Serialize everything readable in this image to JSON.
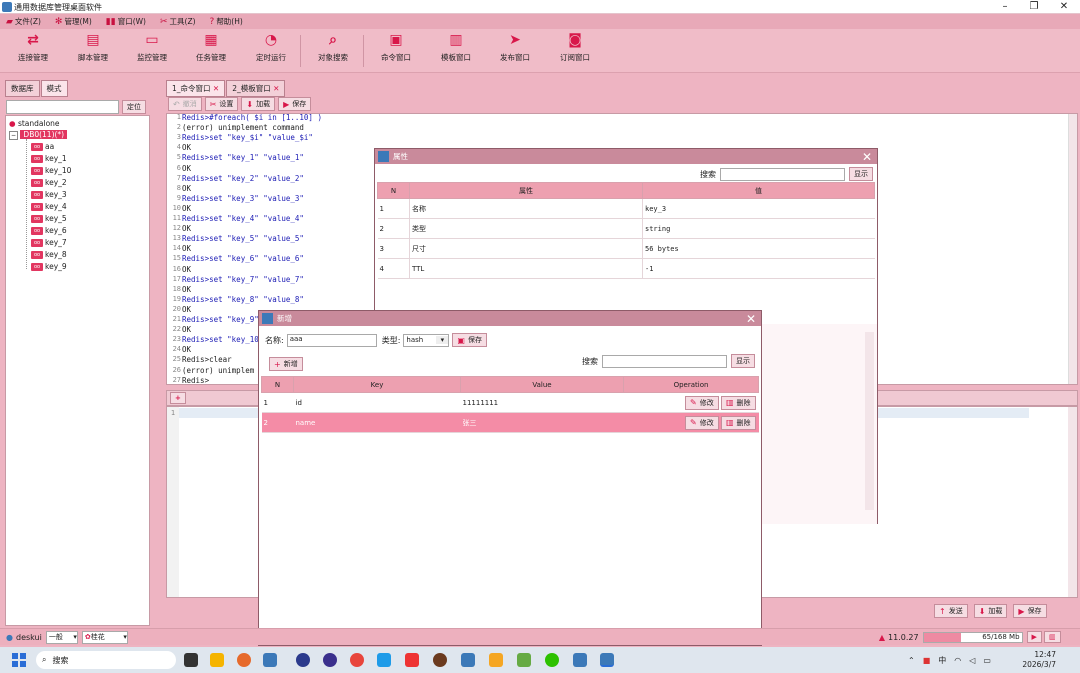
{
  "window": {
    "title": "通用数据库管理桌面软件"
  },
  "menu": [
    "文件(Z)",
    "管理(M)",
    "窗口(W)",
    "工具(Z)",
    "帮助(H)"
  ],
  "toolbar": [
    "连接管理",
    "脚本管理",
    "监控管理",
    "任务管理",
    "定时运行",
    "对象搜索",
    "命令窗口",
    "模板窗口",
    "发布窗口",
    "订阅窗口"
  ],
  "left": {
    "tabs": [
      "数据库",
      "模式"
    ],
    "locate_label": "定位",
    "root": "standalone",
    "db": "DB0(11)(*)",
    "keys": [
      "aa",
      "key_1",
      "key_10",
      "key_2",
      "key_3",
      "key_4",
      "key_5",
      "key_6",
      "key_7",
      "key_8",
      "key_9"
    ]
  },
  "doc_tabs": [
    "1_命令窗口",
    "2_模板窗口"
  ],
  "edit_toolbar": {
    "run": "撤消",
    "settings": "设置",
    "load": "加载",
    "save": "保存"
  },
  "console": [
    {
      "n": "1",
      "kind": "cmd",
      "t": "Redis>#foreach( $i in [1..10] )"
    },
    {
      "n": "2",
      "kind": "out",
      "t": "(error) unimplement command"
    },
    {
      "n": "3",
      "kind": "cmd",
      "t": "Redis>set \"key_$i\" \"value_$i\""
    },
    {
      "n": "4",
      "kind": "out",
      "t": "OK"
    },
    {
      "n": "5",
      "kind": "cmd",
      "t": "Redis>set \"key_1\" \"value_1\""
    },
    {
      "n": "6",
      "kind": "out",
      "t": "OK"
    },
    {
      "n": "7",
      "kind": "cmd",
      "t": "Redis>set \"key_2\" \"value_2\""
    },
    {
      "n": "8",
      "kind": "out",
      "t": "OK"
    },
    {
      "n": "9",
      "kind": "cmd",
      "t": "Redis>set \"key_3\" \"value_3\""
    },
    {
      "n": "10",
      "kind": "out",
      "t": "OK"
    },
    {
      "n": "11",
      "kind": "cmd",
      "t": "Redis>set \"key_4\" \"value_4\""
    },
    {
      "n": "12",
      "kind": "out",
      "t": "OK"
    },
    {
      "n": "13",
      "kind": "cmd",
      "t": "Redis>set \"key_5\" \"value_5\""
    },
    {
      "n": "14",
      "kind": "out",
      "t": "OK"
    },
    {
      "n": "15",
      "kind": "cmd",
      "t": "Redis>set \"key_6\" \"value_6\""
    },
    {
      "n": "16",
      "kind": "out",
      "t": "OK"
    },
    {
      "n": "17",
      "kind": "cmd",
      "t": "Redis>set \"key_7\" \"value_7\""
    },
    {
      "n": "18",
      "kind": "out",
      "t": "OK"
    },
    {
      "n": "19",
      "kind": "cmd",
      "t": "Redis>set \"key_8\" \"value_8\""
    },
    {
      "n": "20",
      "kind": "out",
      "t": "OK"
    },
    {
      "n": "21",
      "kind": "cmd",
      "t": "Redis>set \"key_9\""
    },
    {
      "n": "22",
      "kind": "out",
      "t": "OK"
    },
    {
      "n": "23",
      "kind": "cmd",
      "t": "Redis>set \"key_10"
    },
    {
      "n": "24",
      "kind": "out",
      "t": "OK"
    },
    {
      "n": "25",
      "kind": "out",
      "t": "Redis>clear"
    },
    {
      "n": "26",
      "kind": "out",
      "t": "(error) unimplem"
    },
    {
      "n": "27",
      "kind": "out",
      "t": "Redis>"
    }
  ],
  "input_line": "1",
  "props_dialog": {
    "title": "属性",
    "search_label": "搜索",
    "show_btn": "显示",
    "cols": [
      "N",
      "属性",
      "值"
    ],
    "rows": [
      [
        "1",
        "名称",
        "key_3"
      ],
      [
        "2",
        "类型",
        "string"
      ],
      [
        "3",
        "尺寸",
        "56 bytes"
      ],
      [
        "4",
        "TTL",
        "-1"
      ]
    ]
  },
  "new_dialog": {
    "title": "新增",
    "name_label": "名称:",
    "name_value": "aaa",
    "type_label": "类型:",
    "type_value": "hash",
    "save_btn": "保存",
    "add_btn": "新增",
    "search_label": "搜索",
    "show_btn": "显示",
    "cols": [
      "N",
      "Key",
      "Value",
      "Operation"
    ],
    "rows": [
      {
        "n": "1",
        "key": "id",
        "value": "11111111",
        "edit": "修改",
        "del": "删除"
      },
      {
        "n": "2",
        "key": "name",
        "value": "张三",
        "edit": "修改",
        "del": "删除"
      }
    ]
  },
  "bottom_btns": {
    "send": "发送",
    "load": "加载",
    "save": "保存"
  },
  "status": {
    "user": "deskui",
    "level": "一般",
    "theme": "桂花",
    "version": "11.0.27",
    "mem": "65/168 Mb"
  },
  "taskbar": {
    "search": "搜索",
    "ime": "中",
    "time": "12:47",
    "date": "2026/3/7"
  }
}
